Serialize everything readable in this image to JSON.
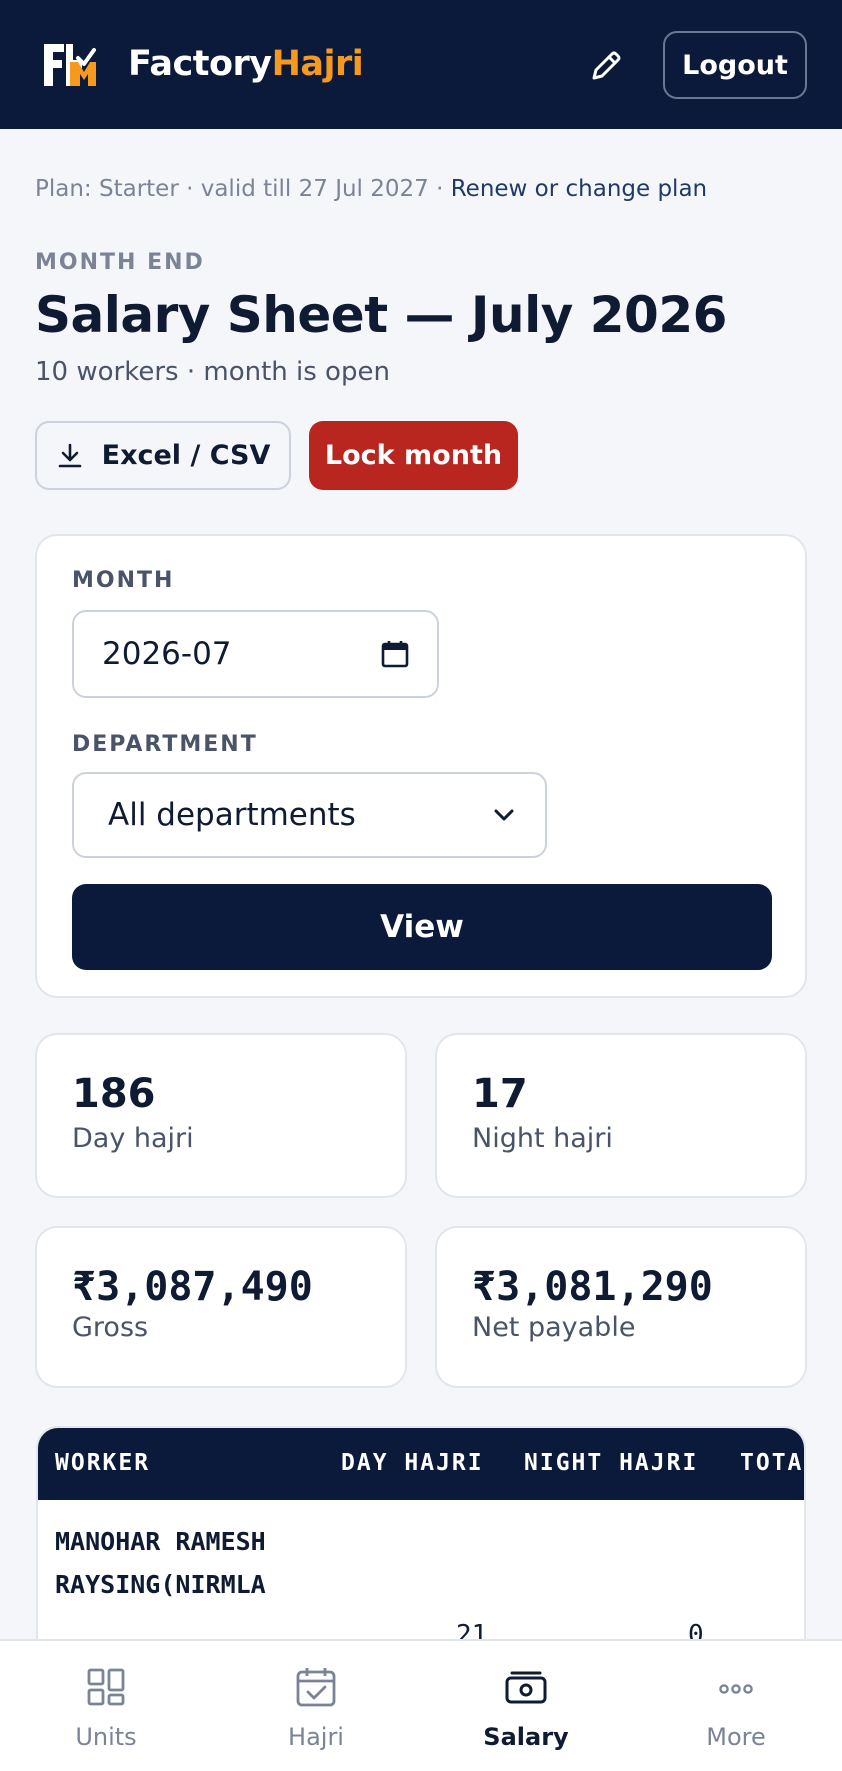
{
  "header": {
    "brand_part1": "Factory",
    "brand_part2": "Hajri",
    "logout_label": "Logout",
    "colors": {
      "bg": "#0b1a3a",
      "accent": "#f59a1f"
    },
    "icons": {
      "logo": "factoryhajri-logo-icon",
      "edit": "pencil-icon"
    }
  },
  "plan": {
    "text": "Plan: Starter · valid till 27 Jul 2027 · ",
    "link": "Renew or change plan"
  },
  "page": {
    "eyebrow": "MONTH END",
    "title": "Salary Sheet — July 2026",
    "subtitle": "10 workers · month is open"
  },
  "actions": {
    "export_label": "Excel / CSV",
    "export_icon": "download-icon",
    "lock_label": "Lock month",
    "lock_color": "#b8261f"
  },
  "filters": {
    "month_label": "MONTH",
    "month_value": "2026-07",
    "department_label": "DEPARTMENT",
    "department_value": "All departments",
    "view_label": "View"
  },
  "stats": [
    {
      "value": "186",
      "label": "Day hajri"
    },
    {
      "value": "17",
      "label": "Night hajri"
    },
    {
      "value": "₹3,087,490",
      "label": "Gross"
    },
    {
      "value": "₹3,081,290",
      "label": "Net payable"
    }
  ],
  "table": {
    "columns": [
      "WORKER",
      "DAY HAJRI",
      "NIGHT HAJRI",
      "TOTA"
    ],
    "rows": [
      {
        "worker": "MANOHAR RAMESH RAYSING(NIRMLA",
        "day_hajri": "21",
        "night_hajri": "0"
      }
    ]
  },
  "nav": {
    "items": [
      {
        "label": "Units",
        "icon": "grid-icon"
      },
      {
        "label": "Hajri",
        "icon": "calendar-check-icon"
      },
      {
        "label": "Salary",
        "icon": "cash-icon",
        "active": true
      },
      {
        "label": "More",
        "icon": "more-dots-icon"
      }
    ]
  }
}
